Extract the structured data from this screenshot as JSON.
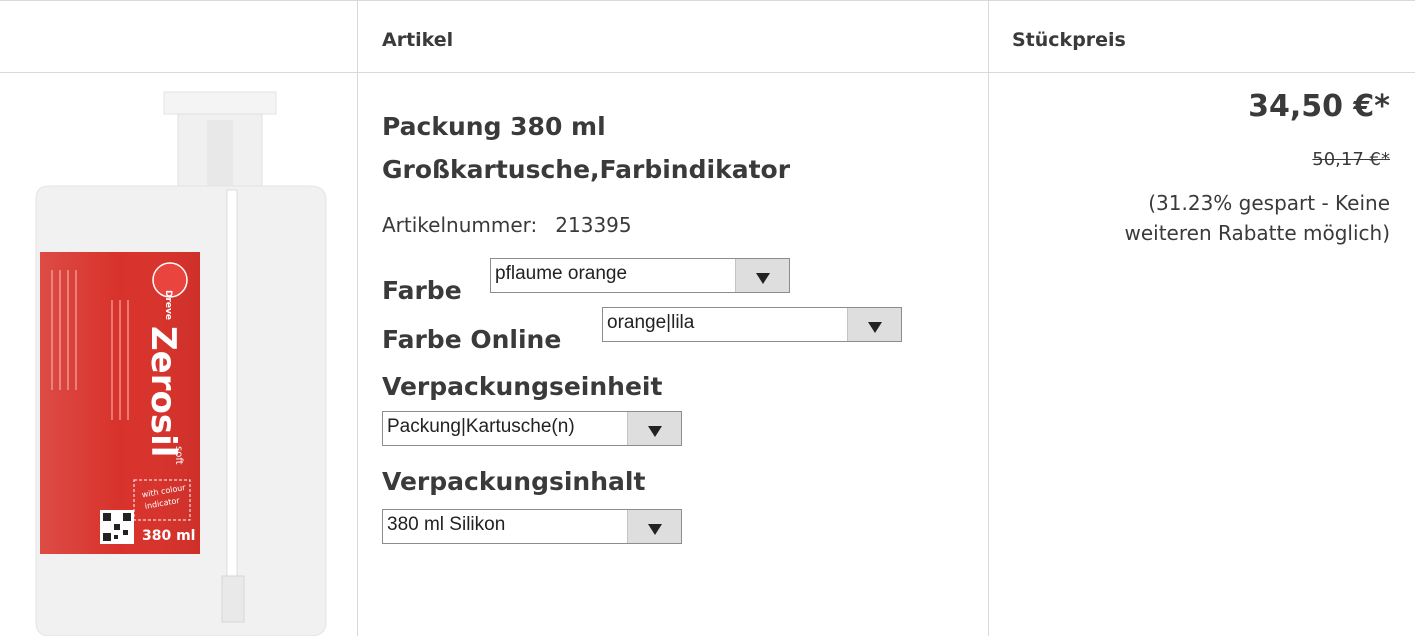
{
  "header": {
    "col_article": "Artikel",
    "col_price": "Stückpreis"
  },
  "product": {
    "title_line1": "Packung 380 ml",
    "title_line2": "Großkartusche,Farbindikator",
    "article_number_label": "Artikelnummer:",
    "article_number": "213395",
    "image": {
      "brand": "Dreve",
      "name": "Zerosil",
      "variant": "soft",
      "badge_line1": "with colour",
      "badge_line2": "indicator",
      "volume": "380 ml",
      "label_color": "#d8322b",
      "body_color": "#f1f1f1"
    }
  },
  "options": {
    "farbe": {
      "label": "Farbe",
      "value": "pflaume orange"
    },
    "farbe_online": {
      "label": "Farbe Online",
      "value": "orange|lila"
    },
    "verpackungseinheit": {
      "label": "Verpackungseinheit",
      "value": "Packung|Kartusche(n)"
    },
    "verpackungsinhalt": {
      "label": "Verpackungsinhalt",
      "value": "380 ml Silikon"
    }
  },
  "pricing": {
    "price": "34,50 €*",
    "old_price": "50,17 €*",
    "saving_line1": "(31.23% gespart - Keine",
    "saving_line2": "weiteren Rabatte möglich)"
  }
}
